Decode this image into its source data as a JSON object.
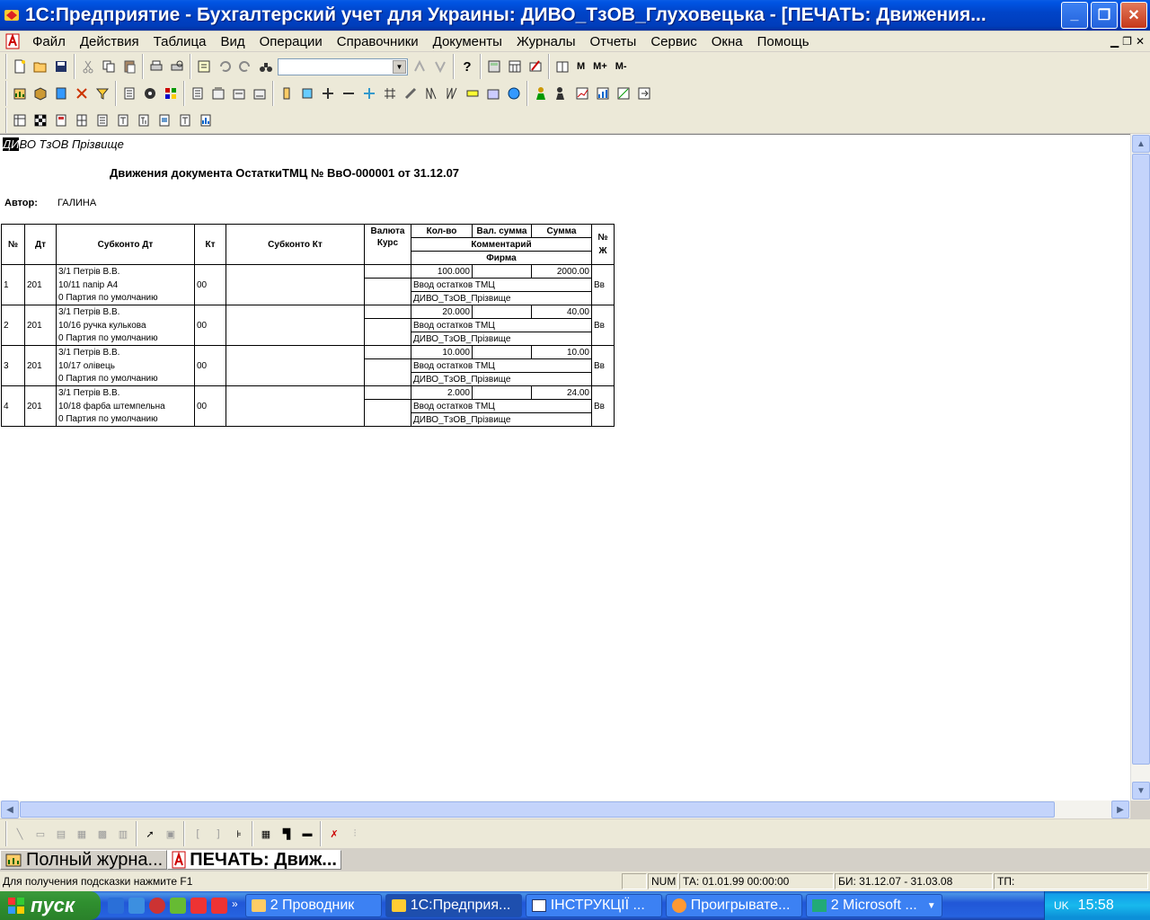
{
  "window": {
    "title": "1С:Предприятие - Бухгалтерский учет для Украины: ДИВО_ТзОВ_Глуховецька - [ПЕЧАТЬ: Движения...",
    "minimize": "_",
    "maximize": "❐",
    "close": "✕"
  },
  "menu": [
    "Файл",
    "Действия",
    "Таблица",
    "Вид",
    "Операции",
    "Справочники",
    "Документы",
    "Журналы",
    "Отчеты",
    "Сервис",
    "Окна",
    "Помощь"
  ],
  "toolbar": {
    "m": "M",
    "m_plus": "M+",
    "m_minus": "M-",
    "combo_value": ""
  },
  "document": {
    "company_hl": "ДИ",
    "company_rest": "ВО ТзОВ Прізвище",
    "title": "Движения документа ОстаткиТМЦ № ВвО-000001 от 31.12.07",
    "author_label": "Автор:",
    "author": "ГАЛИНА",
    "headers": {
      "no": "№",
      "dt": "Дт",
      "subkonto_dt": "Субконто Дт",
      "kt": "Кт",
      "subkonto_kt": "Субконто Кт",
      "currency": "Валюта",
      "rate": "Курс",
      "qty": "Кол-во",
      "cur_sum": "Вал. сумма",
      "sum": "Сумма",
      "comment": "Комментарий",
      "firm": "Фирма",
      "journal": "№ Ж"
    },
    "rows": [
      {
        "no": "1",
        "dt": "201",
        "sub1": "3/1 Петрів В.В.",
        "sub2": "10/11 папір А4",
        "sub3": "0 Партия по умолчанию",
        "kt": "00",
        "qty": "100.000",
        "sum": "2000.00",
        "comment": "Ввод остатков ТМЦ",
        "firm": "ДИВО_ТзОВ_Прізвище",
        "journal": "Вв"
      },
      {
        "no": "2",
        "dt": "201",
        "sub1": "3/1 Петрів В.В.",
        "sub2": "10/16 ручка кулькова",
        "sub3": "0 Партия по умолчанию",
        "kt": "00",
        "qty": "20.000",
        "sum": "40.00",
        "comment": "Ввод остатков ТМЦ",
        "firm": "ДИВО_ТзОВ_Прізвище",
        "journal": "Вв"
      },
      {
        "no": "3",
        "dt": "201",
        "sub1": "3/1 Петрів В.В.",
        "sub2": "10/17 олівець",
        "sub3": "0 Партия по умолчанию",
        "kt": "00",
        "qty": "10.000",
        "sum": "10.00",
        "comment": "Ввод остатков ТМЦ",
        "firm": "ДИВО_ТзОВ_Прізвище",
        "journal": "Вв"
      },
      {
        "no": "4",
        "dt": "201",
        "sub1": "3/1 Петрів В.В.",
        "sub2": "10/18 фарба штемпельна",
        "sub3": "0 Партия по умолчанию",
        "kt": "00",
        "qty": "2.000",
        "sum": "24.00",
        "comment": "Ввод остатков ТМЦ",
        "firm": "ДИВО_ТзОВ_Прізвище",
        "journal": "Вв"
      }
    ]
  },
  "wintabs": [
    "Полный журна...",
    "ПЕЧАТЬ: Движ..."
  ],
  "status": {
    "hint": "Для получения подсказки нажмите F1",
    "num": "NUM",
    "ta": "ТА: 01.01.99  00:00:00",
    "bi": "БИ: 31.12.07 - 31.03.08",
    "tp": "ТП:"
  },
  "taskbar": {
    "start": "пуск",
    "tasks": [
      "2 Проводник",
      "1С:Предприя...",
      "ІНСТРУКЦІЇ ...",
      "Проигрывате...",
      "2 Microsoft ..."
    ],
    "lang": "UK",
    "clock": "15:58"
  }
}
